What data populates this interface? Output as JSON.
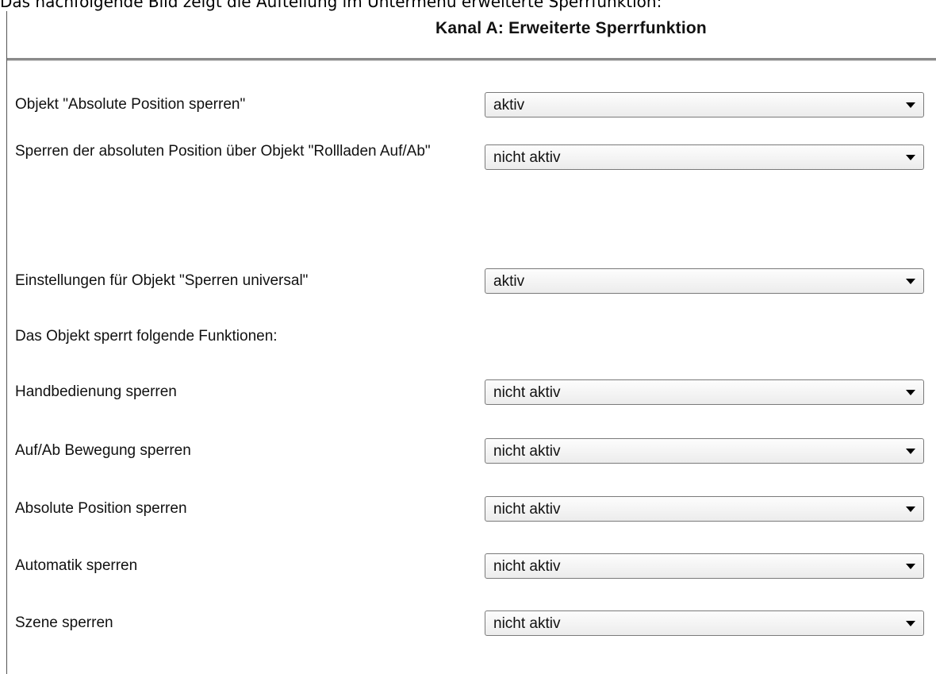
{
  "caption": "Das nachfolgende Bild zeigt die Aufteilung im Untermenü erweiterte Sperrfunktion:",
  "panel": {
    "title": "Kanal A: Erweiterte Sperrfunktion"
  },
  "rows": [
    {
      "label": "Objekt \"Absolute Position sperren\"",
      "value": "aktiv"
    },
    {
      "label": "Sperren der absoluten Position über Objekt \"Rollladen Auf/Ab\"",
      "value": "nicht aktiv"
    },
    {
      "label": "Einstellungen für Objekt \"Sperren universal\"",
      "value": "aktiv"
    },
    {
      "label": "Das Objekt sperrt folgende Funktionen:"
    },
    {
      "label": "Handbedienung sperren",
      "value": "nicht aktiv"
    },
    {
      "label": "Auf/Ab Bewegung sperren",
      "value": "nicht aktiv"
    },
    {
      "label": "Absolute Position sperren",
      "value": "nicht aktiv"
    },
    {
      "label": "Automatik sperren",
      "value": "nicht aktiv"
    },
    {
      "label": "Szene sperren",
      "value": "nicht aktiv"
    }
  ],
  "icons": {
    "dropdown": "chevron-down-icon"
  }
}
